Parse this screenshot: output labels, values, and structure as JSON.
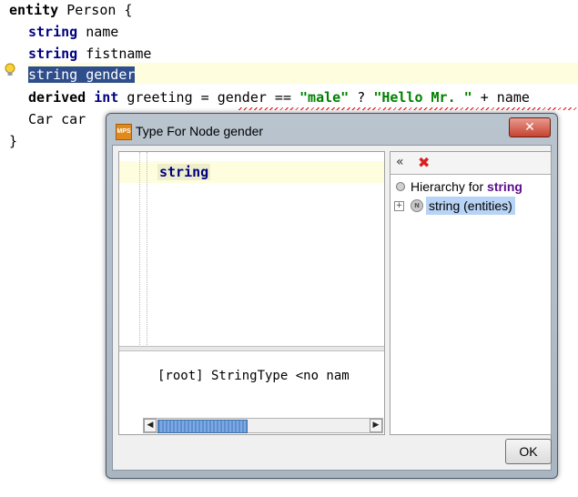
{
  "editor": {
    "lines": [
      {
        "kw": "entity",
        "rest": " Person {"
      },
      {
        "kw": "string",
        "rest": " name"
      },
      {
        "kw": "string",
        "rest": " fistname"
      },
      {
        "selected": "string gender"
      },
      {
        "kw": "derived",
        "type": "int",
        "p1": " greeting = gender == ",
        "s1": "\"male\"",
        "p2": " ? ",
        "s2": "\"Hello Mr. \"",
        "p3": " + name"
      },
      {
        "text": "Car car"
      },
      {
        "text": "}"
      }
    ]
  },
  "dialog": {
    "title": "Type For Node gender",
    "close_label": "✕",
    "app_icon": "MPS",
    "type_text": "string",
    "root_text": "[root] StringType <no nam",
    "hierarchy_prefix": "Hierarchy for ",
    "hierarchy_node": "string",
    "tree_item": "string (entities)",
    "node_icon": "N",
    "ok_label": "OK",
    "collapse_icon": "«",
    "remove_icon": "✖",
    "expand_icon": "+"
  },
  "colors": {
    "keyword": "#000080",
    "string_literal": "#008000",
    "selection": "#2f4e8c",
    "current_line": "#fefedf"
  }
}
